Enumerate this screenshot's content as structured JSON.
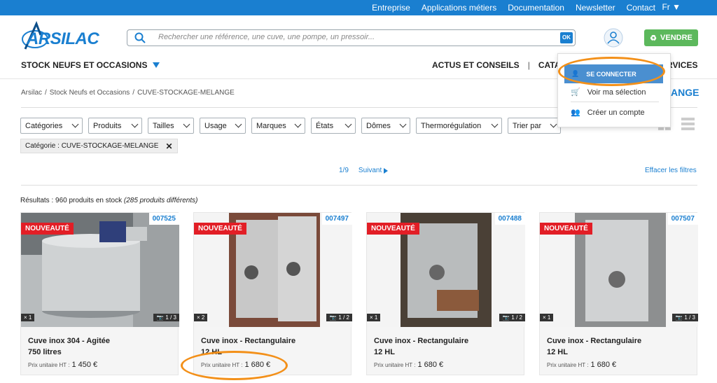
{
  "topbar": {
    "links": [
      "Entreprise",
      "Applications métiers",
      "Documentation",
      "Newsletter",
      "Contact"
    ],
    "lang": "Fr"
  },
  "logo": {
    "text": "ARSILAC"
  },
  "search": {
    "placeholder": "Rechercher une référence, une cuve, une pompe, un pressoir...",
    "button": "OK"
  },
  "sell_button": "VENDRE",
  "nav": {
    "left": "STOCK NEUFS ET OCCASIONS",
    "right": [
      "ACTUS ET CONSEILS",
      "CATALO"
    ],
    "services": "RVICES"
  },
  "breadcrumb": [
    "Arsilac",
    "/",
    "Stock Neufs et Occasions",
    "/",
    "CUVE-STOCKAGE-MELANGE"
  ],
  "page_title_visible": "ANGE",
  "filters": [
    "Catégories",
    "Produits",
    "Tailles",
    "Usage",
    "Marques",
    "États",
    "Dômes",
    "Thermorégulation",
    "Trier par"
  ],
  "active_tag": "Catégorie : CUVE-STOCKAGE-MELANGE",
  "pager": {
    "page": "1/9",
    "next": "Suivant"
  },
  "clear_filters": "Effacer les filtres",
  "results": {
    "main": "Résultats : 960 produits en stock",
    "italic": "(285 produits différents)"
  },
  "products": [
    {
      "badge": "NOUVEAUTÉ",
      "ref": "007525",
      "qty": "× 1",
      "photos": "1 / 3",
      "title_line1": "Cuve inox 304 - Agitée",
      "title_line2": "750 litres",
      "price_label": "Prix unitaire HT :",
      "price": "1 450 €"
    },
    {
      "badge": "NOUVEAUTÉ",
      "ref": "007497",
      "qty": "× 2",
      "photos": "1 / 2",
      "title_line1": "Cuve inox - Rectangulaire",
      "title_line2": "12 HL",
      "price_label": "Prix unitaire HT :",
      "price": "1 680 €"
    },
    {
      "badge": "NOUVEAUTÉ",
      "ref": "007488",
      "qty": "× 1",
      "photos": "1 / 2",
      "title_line1": "Cuve inox - Rectangulaire",
      "title_line2": "12 HL",
      "price_label": "Prix unitaire HT :",
      "price": "1 680 €"
    },
    {
      "badge": "NOUVEAUTÉ",
      "ref": "007507",
      "qty": "× 1",
      "photos": "1 / 3",
      "title_line1": "Cuve inox - Rectangulaire",
      "title_line2": "12 HL",
      "price_label": "Prix unitaire HT :",
      "price": "1 680 €"
    }
  ],
  "account_menu": {
    "login": "SE CONNECTER",
    "selection": "Voir ma sélection",
    "create": "Créer un compte"
  },
  "colors": {
    "brand_blue": "#1a7fd0",
    "sell_green": "#5cb85c",
    "badge_red": "#e21e26",
    "highlight_orange": "#f39019"
  }
}
